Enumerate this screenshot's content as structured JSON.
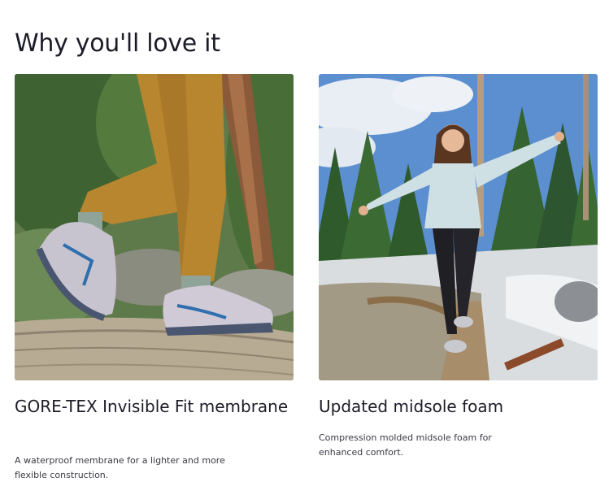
{
  "section": {
    "title": "Why you'll love it"
  },
  "features": [
    {
      "title": "GORE-TEX Invisible Fit membrane",
      "description": "A waterproof membrane for a lighter and more flexible construction."
    },
    {
      "title": "Updated midsole foam",
      "description": "Compression molded midsole foam for enhanced comfort."
    }
  ]
}
